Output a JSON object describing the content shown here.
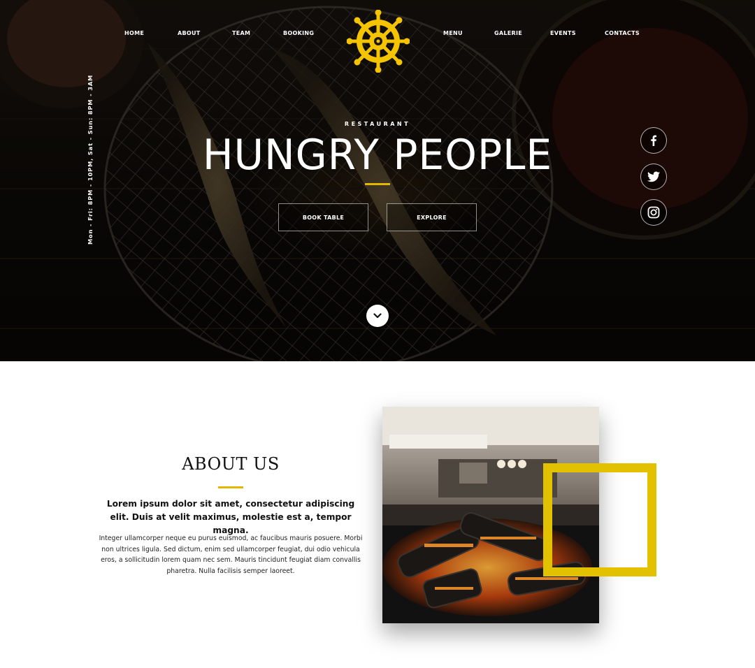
{
  "nav": {
    "left": [
      {
        "label": "HOME"
      },
      {
        "label": "ABOUT"
      },
      {
        "label": "TEAM"
      },
      {
        "label": "BOOKING"
      }
    ],
    "right": [
      {
        "label": "MENU"
      },
      {
        "label": "GALERIE"
      },
      {
        "label": "EVENTS"
      },
      {
        "label": "CONTACTS"
      }
    ]
  },
  "hero": {
    "opening_hours": "Mon - Fri: 8PM - 10PM, Sat - Sun: 8PM - 3AM",
    "eyebrow": "RESTAURANT",
    "title": "HUNGRY PEOPLE",
    "buttons": {
      "book": "BOOK TABLE",
      "explore": "EXPLORE"
    },
    "social": [
      "facebook-icon",
      "twitter-icon",
      "instagram-icon"
    ]
  },
  "about": {
    "title": "ABOUT US",
    "lead": "Lorem ipsum dolor sit amet, consectetur adipiscing elit. Duis at velit maximus, molestie est a, tempor magna.",
    "body": "Integer ullamcorper neque eu purus euismod, ac faucibus mauris posuere. Morbi non ultrices ligula. Sed dictum, enim sed ullamcorper feugiat, dui odio vehicula eros, a sollicitudin lorem quam nec sem. Mauris tincidunt feugiat diam convallis pharetra. Nulla facilisis semper laoreet."
  },
  "colors": {
    "accent": "#e2b700",
    "frame": "#e2c100",
    "hero_bg": "#0e0b08",
    "text_dark": "#111111"
  }
}
